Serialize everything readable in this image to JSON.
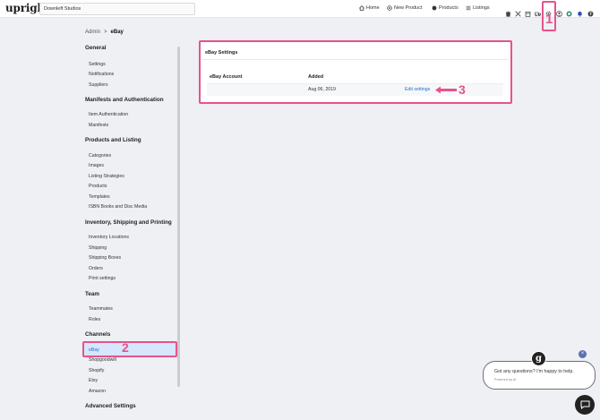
{
  "app": {
    "logo": "upright",
    "store_name": "Downleft Studios"
  },
  "nav": {
    "home": "Home",
    "new_product": "New Product",
    "products": "Products",
    "listings": "Listings"
  },
  "breadcrumb": {
    "parent": "Admin",
    "separator": ">",
    "current": "eBay"
  },
  "sidebar": {
    "sections": [
      {
        "title": "General",
        "items": [
          "Settings",
          "Notifications",
          "Suppliers"
        ]
      },
      {
        "title": "Manifests and Authentication",
        "items": [
          "Item Authentication",
          "Manifests"
        ]
      },
      {
        "title": "Products and Listing",
        "items": [
          "Categories",
          "Images",
          "Listing Strategies",
          "Products",
          "Templates",
          "ISBN Books and Disc Media"
        ]
      },
      {
        "title": "Inventory, Shipping and Printing",
        "items": [
          "Inventory Locations",
          "Shipping",
          "Shipping Boxes",
          "Orders",
          "Print settings"
        ]
      },
      {
        "title": "Team",
        "items": [
          "Teammates",
          "Roles"
        ]
      },
      {
        "title": "Channels",
        "items": [
          "eBay",
          "Shopgoodwill",
          "Shopify",
          "Etsy",
          "Amazon"
        ]
      },
      {
        "title": "Advanced Settings",
        "items": []
      }
    ],
    "active_item": "eBay"
  },
  "card": {
    "title": "eBay Settings",
    "columns": [
      "eBay Account",
      "Added"
    ],
    "rows": [
      {
        "account": "",
        "added": "Aug 06, 2019",
        "action": "Edit settings"
      }
    ]
  },
  "annotations": {
    "step1": "1",
    "step2": "2",
    "step3": "3",
    "color": "#e8528e"
  },
  "chat": {
    "avatar_letter": "g",
    "message": "Got any questions? I'm happy to help.",
    "powered": "Powered by AI",
    "close": "×"
  },
  "colors": {
    "accent": "#1e6fd0",
    "active_bg": "#d6e6fb",
    "page_bg": "#eef0f3"
  }
}
